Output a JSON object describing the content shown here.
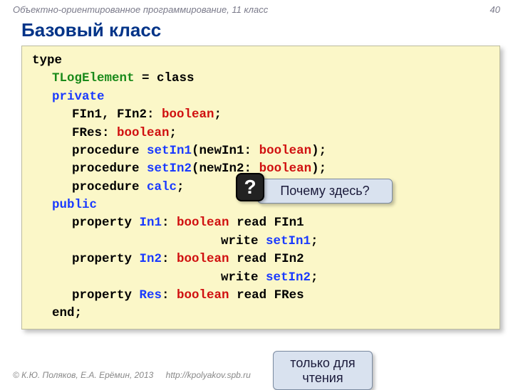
{
  "header": {
    "course": "Объектно-ориентированное программирование, 11 класс",
    "page": "40"
  },
  "title": "Базовый класс",
  "code": {
    "kw_type": "type",
    "classname": "TLogElement",
    "eq_class": " = class",
    "kw_private": "private",
    "fields1_a": "FIn1, FIn2: ",
    "fields2_a": "FRes: ",
    "bool": "boolean",
    "semi": ";",
    "proc": "procedure ",
    "setIn1": "setIn1",
    "setIn1_args": "(newIn1: ",
    "setIn2": "setIn2",
    "setIn2_args": "(newIn2: ",
    "close_paren_semi": ");",
    "calc": "calc",
    "kw_public": "public",
    "property": "property ",
    "In1": "In1",
    "colon_sp": ": ",
    "read": " read ",
    "FIn1": "FIn1",
    "write_sp": "write ",
    "In2": "In2",
    "FIn2": "FIn2",
    "Res": "Res",
    "FRes": "FRes",
    "end": "end"
  },
  "callouts": {
    "q_badge": "?",
    "why_here": "Почему здесь?",
    "readonly": "только для чтения"
  },
  "footer": {
    "copyright": "© К.Ю. Поляков, Е.А. Ерёмин, 2013",
    "url": "http://kpolyakov.spb.ru"
  }
}
